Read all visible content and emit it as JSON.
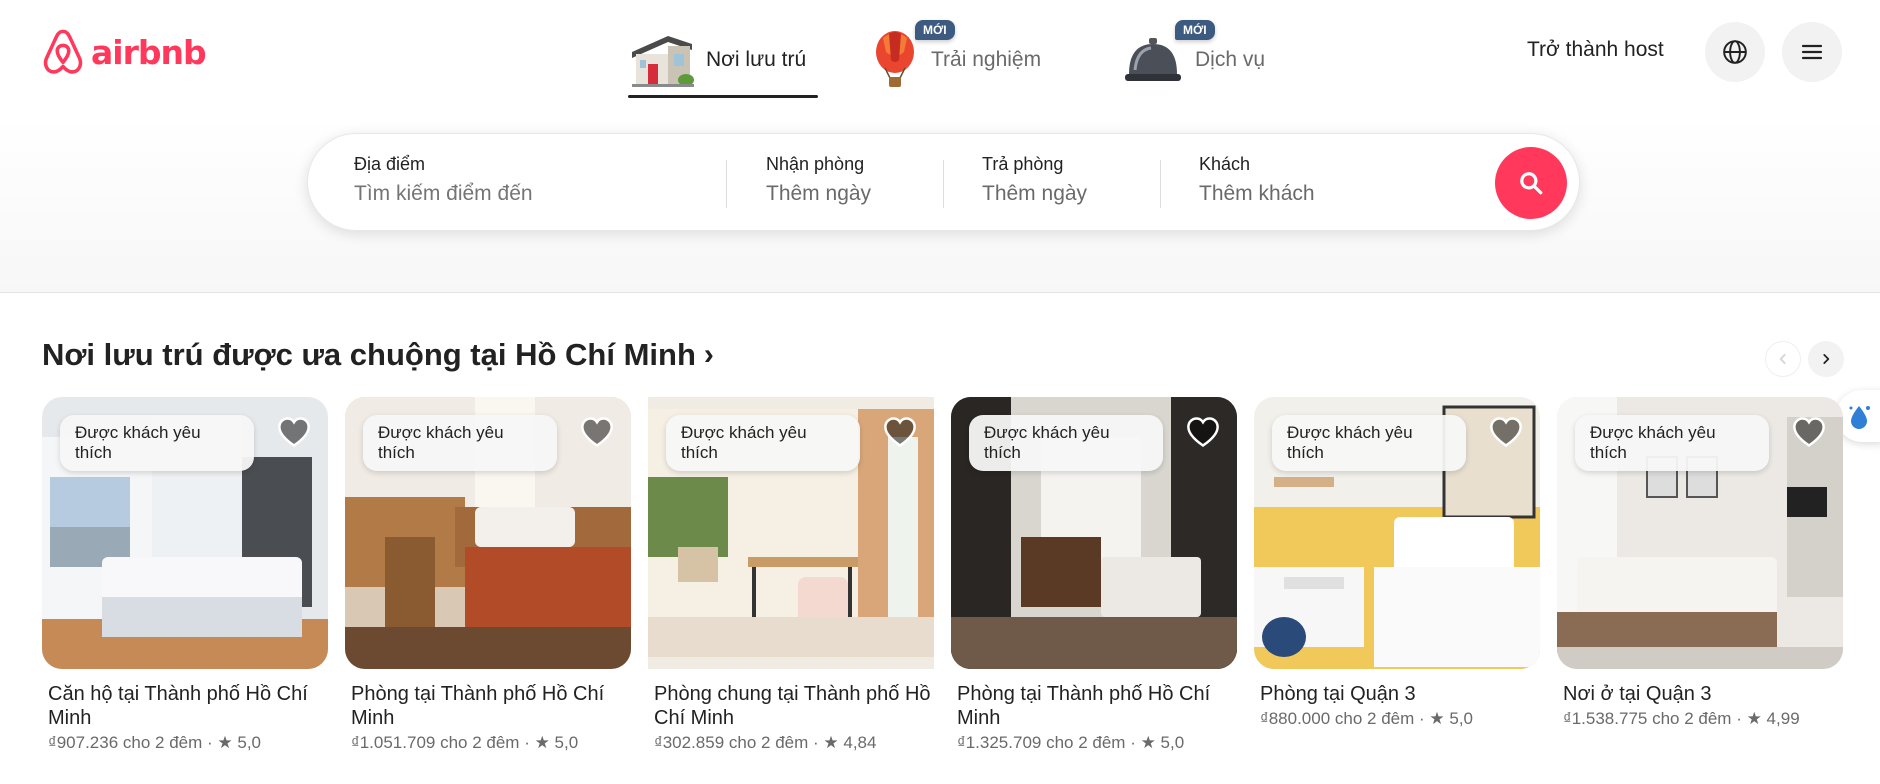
{
  "header": {
    "logo_text": "airbnb",
    "tabs": [
      {
        "label": "Nơi lưu trú",
        "badge": ""
      },
      {
        "label": "Trải nghiệm",
        "badge": "MỚI"
      },
      {
        "label": "Dịch vụ",
        "badge": "MỚI"
      }
    ],
    "host_link": "Trở thành host",
    "icons": {
      "language": "globe-icon",
      "menu": "hamburger-menu-icon"
    }
  },
  "search": {
    "location_label": "Địa điểm",
    "location_placeholder": "Tìm kiếm điểm đến",
    "checkin_label": "Nhận phòng",
    "checkin_value": "Thêm ngày",
    "checkout_label": "Trả phòng",
    "checkout_value": "Thêm ngày",
    "guests_label": "Khách",
    "guests_value": "Thêm khách"
  },
  "section": {
    "title": "Nơi lưu trú được ưa chuộng tại Hồ Chí Minh",
    "chevron": "›"
  },
  "listings": [
    {
      "badge": "Được khách yêu thích",
      "title": "Căn hộ tại Thành phố Hồ Chí Minh",
      "price": "₫907.236 cho 2 đêm",
      "rating": "★ 5,0"
    },
    {
      "badge": "Được khách yêu thích",
      "title": "Phòng tại Thành phố Hồ Chí Minh",
      "price": "₫1.051.709 cho 2 đêm",
      "rating": "★ 5,0"
    },
    {
      "badge": "Được khách yêu thích",
      "title": "Phòng chung tại Thành phố Hồ Chí Minh",
      "price": "₫302.859 cho 2 đêm",
      "rating": "★ 4,84"
    },
    {
      "badge": "Được khách yêu thích",
      "title": "Phòng tại Thành phố Hồ Chí Minh",
      "price": "₫1.325.709 cho 2 đêm",
      "rating": "★ 5,0"
    },
    {
      "badge": "Được khách yêu thích",
      "title": "Phòng tại Quận 3",
      "price": "₫880.000 cho 2 đêm",
      "rating": "★ 5,0"
    },
    {
      "badge": "Được khách yêu thích",
      "title": "Nơi ở tại Quận 3",
      "price": "₫1.538.775 cho 2 đêm",
      "rating": "★ 4,99"
    }
  ],
  "colors": {
    "brand": "#ff385c",
    "text": "#222222",
    "muted": "#6a6a6a",
    "badge_new": "#3d5a80"
  }
}
